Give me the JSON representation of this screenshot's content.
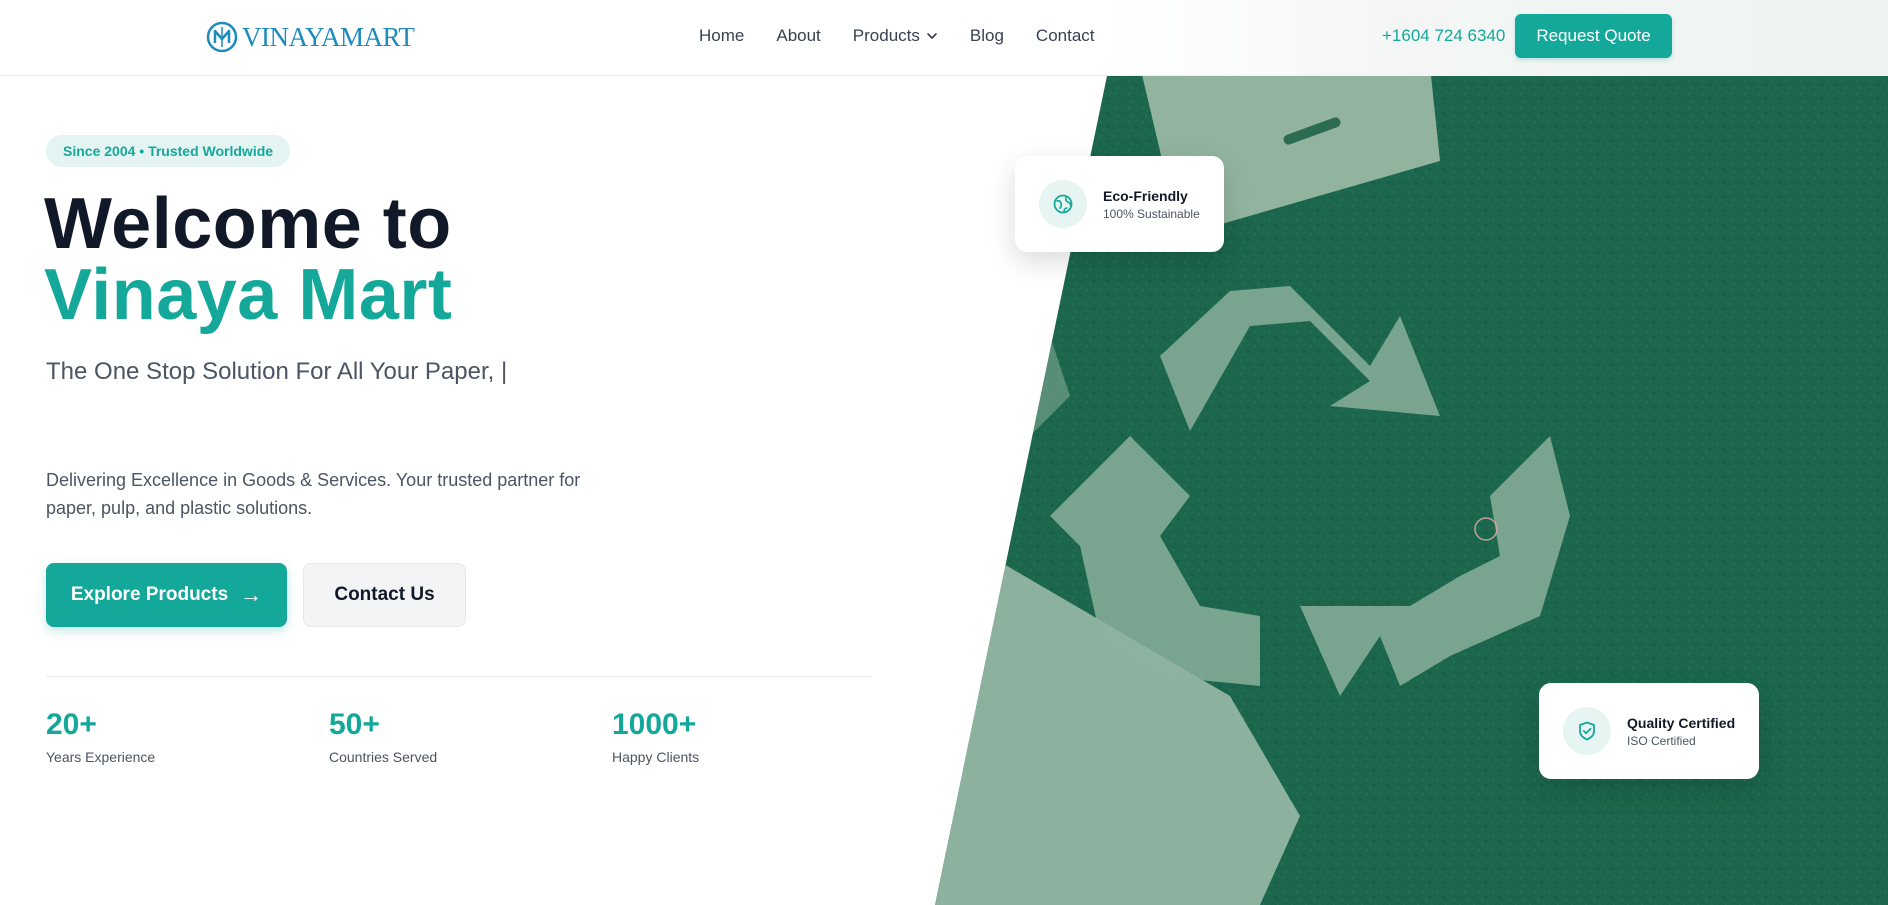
{
  "brand": {
    "name": "VINAYAMART",
    "color": "#1e8bbf"
  },
  "nav": {
    "items": [
      {
        "label": "Home"
      },
      {
        "label": "About"
      },
      {
        "label": "Products",
        "has_dropdown": true
      },
      {
        "label": "Blog"
      },
      {
        "label": "Contact"
      }
    ],
    "phone": "+1604 724 6340",
    "cta": "Request Quote"
  },
  "hero": {
    "badge": "Since 2004 • Trusted Worldwide",
    "title_line1": "Welcome to",
    "title_line2": "Vinaya Mart",
    "subtitle": "The One Stop Solution For All Your Paper, |",
    "description": "Delivering Excellence in Goods & Services. Your trusted partner for paper, pulp, and plastic solutions.",
    "primary_button": "Explore Products",
    "primary_button_icon": "arrow-right-icon",
    "secondary_button": "Contact Us",
    "image_subject": "recycle-symbol-on-grass-with-paper-bags"
  },
  "stats": [
    {
      "value": "20+",
      "label": "Years Experience"
    },
    {
      "value": "50+",
      "label": "Countries Served"
    },
    {
      "value": "1000+",
      "label": "Happy Clients"
    }
  ],
  "cards": {
    "eco": {
      "title": "Eco-Friendly",
      "subtitle": "100% Sustainable",
      "icon": "globe-icon"
    },
    "quality": {
      "title": "Quality Certified",
      "subtitle": "ISO Certified",
      "icon": "shield-check-icon"
    }
  },
  "colors": {
    "accent": "#14a89a",
    "heading": "#111827",
    "body_text": "#4b5563",
    "badge_bg": "#e4f4f2",
    "grass_green": "#1f6a4f"
  }
}
